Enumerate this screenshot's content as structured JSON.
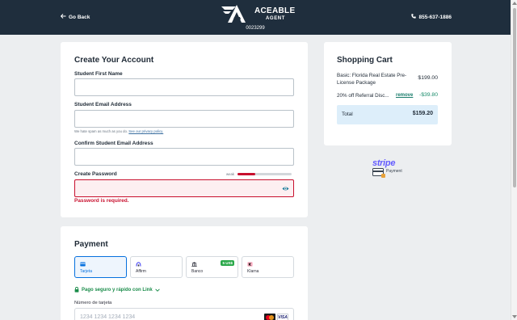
{
  "header": {
    "go_back": "Go Back",
    "logo_line1": "ACEABLE",
    "logo_line2": "AGENT",
    "order_id": "0023299",
    "phone": "855-637-1886"
  },
  "account": {
    "title": "Create Your Account",
    "first_name_label": "Student First Name",
    "first_name_value": "",
    "email_label": "Student Email Address",
    "email_value": "",
    "email_hint": "We hate spam as much as you do.",
    "privacy_link": "See our privacy policy.",
    "confirm_email_label": "Confirm Student Email Address",
    "confirm_email_value": "",
    "password_label": "Create Password",
    "password_value": "",
    "strength_label": "weak",
    "strength_fraction": 0.33,
    "password_error": "Password is required."
  },
  "cart": {
    "title": "Shopping Cart",
    "item_name_line1": "Basic: Florida Real Estate Pre-",
    "item_name_line2": "License Package",
    "item_price": "$199.00",
    "discount_name": "20% off Referral Disc...",
    "remove_label": "remove",
    "discount_price": "-$39.80",
    "total_label": "Total",
    "total_value": "$159.20"
  },
  "stripe": {
    "brand": "stripe",
    "label": "Payment"
  },
  "payment": {
    "title": "Payment",
    "methods": [
      {
        "label": "Tarjeta",
        "icon": "card-icon",
        "selected": true
      },
      {
        "label": "Affirm",
        "icon": "affirm-icon",
        "selected": false
      },
      {
        "label": "Banco",
        "icon": "bank-icon",
        "selected": false,
        "badge": "5 US$"
      },
      {
        "label": "Klarna",
        "icon": "klarna-icon",
        "selected": false
      }
    ],
    "link_text": "Pago seguro y rápido con Link",
    "card_number_label": "Número de tarjeta",
    "card_number_placeholder": "1234 1234 1234 1234",
    "visa_text": "VISA"
  },
  "colors": {
    "header_bg": "#1f2e3d",
    "error": "#c8102e",
    "link_green": "#1a8c4a",
    "stripe_purple": "#635bff",
    "selected_blue": "#0570de"
  }
}
